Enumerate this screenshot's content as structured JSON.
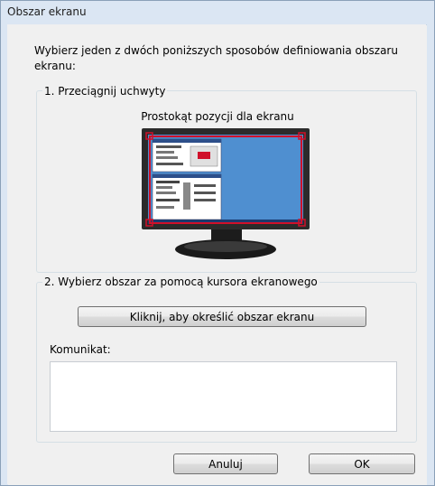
{
  "window": {
    "title": "Obszar ekranu"
  },
  "instructions": "Wybierz jeden z dwóch poniższych sposobów definiowania obszaru ekranu:",
  "section1": {
    "legend": "1. Przeciągnij uchwyty",
    "caption": "Prostokąt pozycji dla ekranu",
    "preview": {
      "screen_color": "#4f8fd0",
      "selection_color": "#d0102a",
      "bezel_color": "#2b2b2b",
      "icon": "monitor-preview"
    }
  },
  "section2": {
    "legend": "2. Wybierz obszar za pomocą kursora ekranowego",
    "button_label": "Kliknij, aby określić obszar ekranu",
    "message_label": "Komunikat:",
    "message_value": ""
  },
  "footer": {
    "cancel_label": "Anuluj",
    "ok_label": "OK"
  }
}
